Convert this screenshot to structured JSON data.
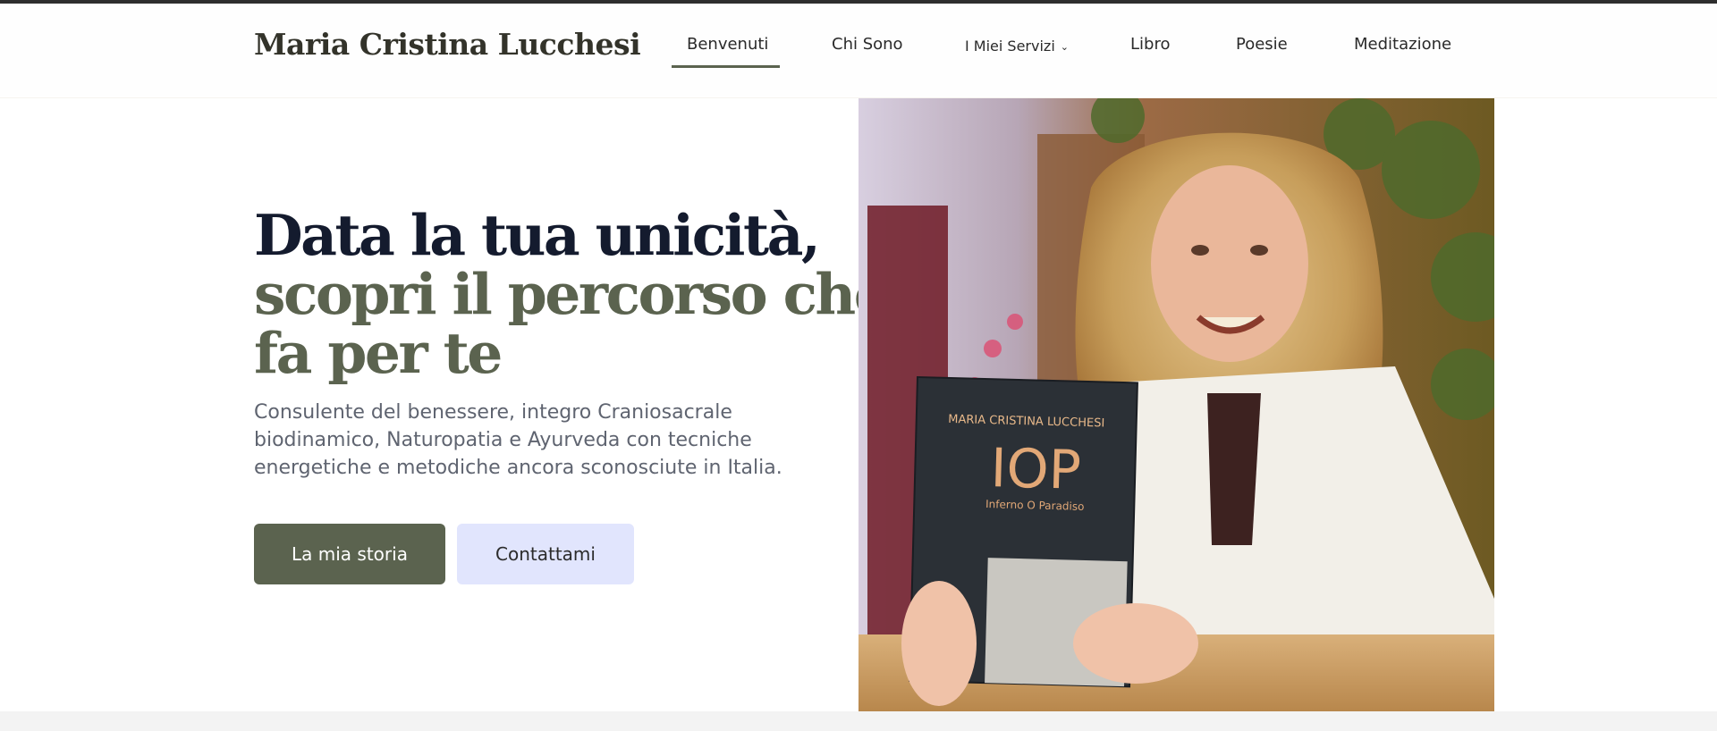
{
  "brand": {
    "name": "Maria Cristina Lucchesi"
  },
  "nav": {
    "items": [
      {
        "label": "Benvenuti",
        "active": true
      },
      {
        "label": "Chi Sono"
      },
      {
        "label": "I Miei Servizi",
        "has_dropdown": true
      },
      {
        "label": "Libro"
      },
      {
        "label": "Poesie"
      },
      {
        "label": "Meditazione"
      }
    ]
  },
  "hero": {
    "headline_line1": "Data la tua unicità,",
    "headline_line2": "scopri il percorso che",
    "headline_line3": "fa per te",
    "subtitle": "Consulente del benessere, integro Craniosacrale biodinamico, Naturopatia e Ayurveda con tecniche energetiche e metodiche ancora sconosciute in Italia.",
    "primary_button": "La mia storia",
    "secondary_button": "Contattami"
  },
  "photo": {
    "book_author": "MARIA CRISTINA LUCCHESI",
    "book_title": "IOP",
    "book_subtitle": "Inferno O Paradiso"
  },
  "colors": {
    "accent": "#5b634f",
    "headline_dark": "#141b2e",
    "secondary_button_bg": "#e1e5fd"
  }
}
